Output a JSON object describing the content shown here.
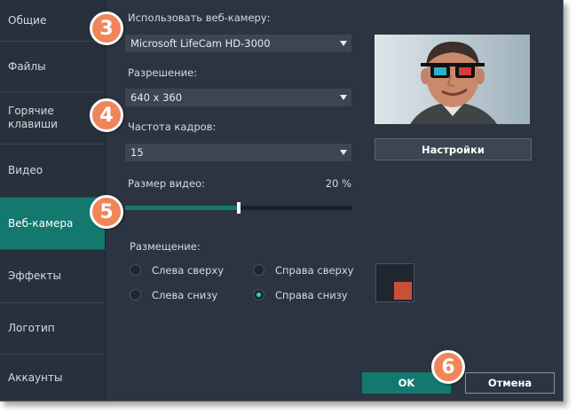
{
  "sidebar": {
    "items": [
      {
        "label": "Общие",
        "active": false
      },
      {
        "label": "Файлы",
        "active": false
      },
      {
        "label": "Горячие\nклавиши",
        "active": false
      },
      {
        "label": "Видео",
        "active": false
      },
      {
        "label": "Веб-камера",
        "active": true
      },
      {
        "label": "Эффекты",
        "active": false
      },
      {
        "label": "Логотип",
        "active": false
      },
      {
        "label": "Аккаунты",
        "active": false
      }
    ]
  },
  "webcam": {
    "use_label": "Использовать веб-камеру:",
    "camera_value": "Microsoft LifeCam HD-3000",
    "resolution_label": "Разрешение:",
    "resolution_value": "640 x 360",
    "fps_label": "Частота кадров:",
    "fps_value": "15",
    "size_label": "Размер видео:",
    "size_percent_text": "20 %",
    "size_level": 0.5,
    "settings_button": "Настройки"
  },
  "placement": {
    "label": "Размещение:",
    "options": [
      {
        "label": "Слева сверху",
        "checked": false
      },
      {
        "label": "Справа сверху",
        "checked": false
      },
      {
        "label": "Слева снизу",
        "checked": false
      },
      {
        "label": "Справа снизу",
        "checked": true
      }
    ]
  },
  "footer": {
    "ok_label": "OK",
    "cancel_label": "Отмена"
  },
  "callouts": [
    "3",
    "4",
    "5",
    "6"
  ],
  "colors": {
    "accent": "#13786d",
    "badge": "#f0855a",
    "preview_overlay": "#c8503a"
  }
}
